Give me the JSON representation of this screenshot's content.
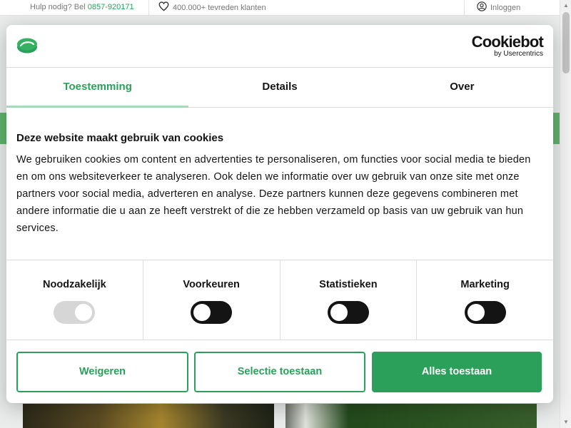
{
  "topbar": {
    "help_text": "Hulp nodig? Bel",
    "phone": "0857-920171",
    "reviews": "400.000+ tevreden klanten",
    "login": "Inloggen"
  },
  "dialog": {
    "cookiebot_word": "Cookiebot",
    "cookiebot_sub": "by Usercentrics",
    "tabs": [
      {
        "label": "Toestemming",
        "active": true
      },
      {
        "label": "Details",
        "active": false
      },
      {
        "label": "Over",
        "active": false
      }
    ],
    "heading": "Deze website maakt gebruik van cookies",
    "body": "We gebruiken cookies om content en advertenties te personaliseren, om functies voor social media te bieden en om ons websiteverkeer te analyseren. Ook delen we informatie over uw gebruik van onze site met onze partners voor social media, adverteren en analyse. Deze partners kunnen deze gegevens combineren met andere informatie die u aan ze heeft verstrekt of die ze hebben verzameld op basis van uw gebruik van hun services.",
    "categories": [
      {
        "label": "Noodzakelijk",
        "checked": true,
        "disabled": true
      },
      {
        "label": "Voorkeuren",
        "checked": false,
        "disabled": false
      },
      {
        "label": "Statistieken",
        "checked": false,
        "disabled": false
      },
      {
        "label": "Marketing",
        "checked": false,
        "disabled": false
      }
    ],
    "buttons": {
      "deny": "Weigeren",
      "select": "Selectie toestaan",
      "allow": "Alles toestaan"
    }
  },
  "colors": {
    "accent": "#2aa05a",
    "toggle_off": "#141414",
    "toggle_disabled": "#d6d6d6"
  }
}
